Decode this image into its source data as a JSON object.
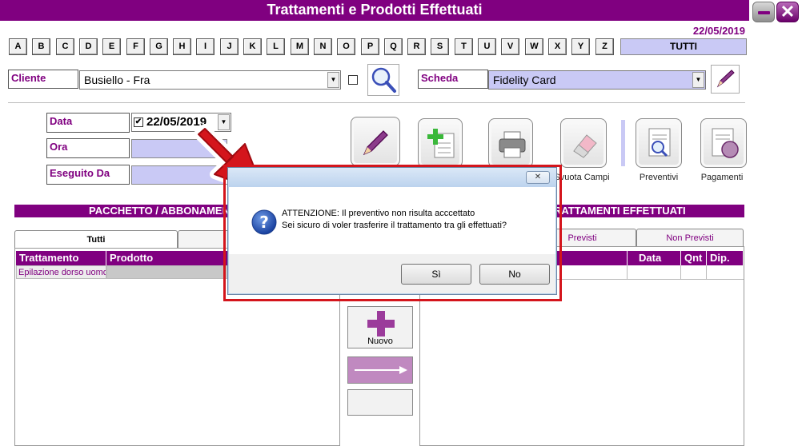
{
  "window": {
    "title": "Trattamenti e Prodotti Effettuati",
    "date": "22/05/2019"
  },
  "alphabet": [
    "A",
    "B",
    "C",
    "D",
    "E",
    "F",
    "G",
    "H",
    "I",
    "J",
    "K",
    "L",
    "M",
    "N",
    "O",
    "P",
    "Q",
    "R",
    "S",
    "T",
    "U",
    "V",
    "W",
    "X",
    "Y",
    "Z"
  ],
  "tutti_label": "TUTTI",
  "cliente": {
    "label": "Cliente",
    "value": "Busiello  -  Fra"
  },
  "scheda": {
    "label": "Scheda",
    "value": "Fidelity Card"
  },
  "form": {
    "data_label": "Data",
    "data_value": "22/05/2019",
    "ora_label": "Ora",
    "eseguito_label": "Eseguito Da"
  },
  "toolbar": {
    "svuota_label": "Svuota Campi",
    "preventivi_label": "Preventivi",
    "pagamenti_label": "Pagamenti"
  },
  "left_section": {
    "title": "PACCHETTO / ABBONAMENTO",
    "tab_tutti": "Tutti",
    "col_trattamento": "Trattamento",
    "col_prodotto": "Prodotto",
    "row_trattamento": "Epilazione dorso uomo"
  },
  "right_section": {
    "title": "TRATTAMENTI EFFETTUATI",
    "tab_previsti": "Previsti",
    "tab_non_previsti": "Non Previsti",
    "col_data": "Data",
    "col_qnt": "Qnt",
    "col_dip": "Dip."
  },
  "side": {
    "nuovo_label": "Nuovo"
  },
  "dialog": {
    "line1": "ATTENZIONE: Il preventivo non risulta acccettato",
    "line2": "Sei sicuro di voler trasferire il trattamento tra gli effettuati?",
    "yes_label": "Sì",
    "no_label": "No",
    "close_glyph": "✕"
  },
  "colors": {
    "brand": "#800080",
    "field": "#c9c9f5",
    "highlight": "#d4151c"
  }
}
